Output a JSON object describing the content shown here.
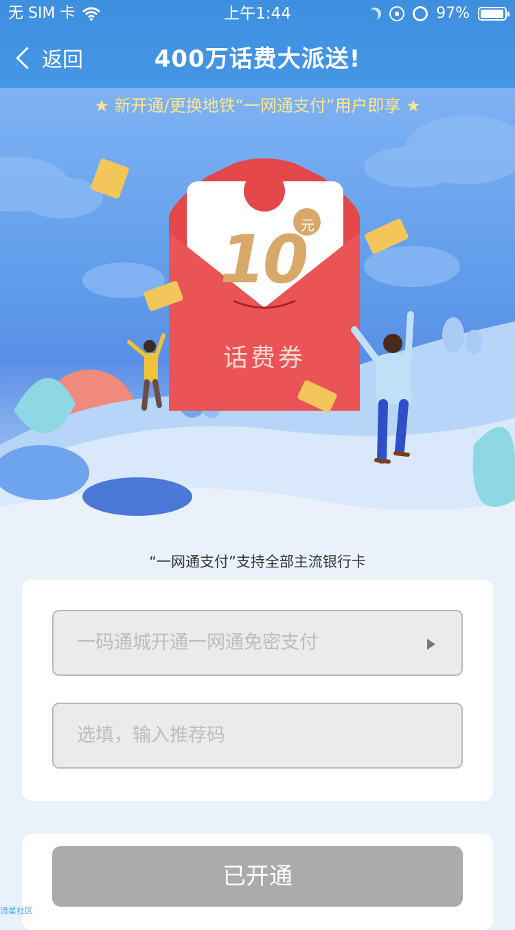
{
  "status_bar": {
    "carrier": "无 SIM 卡",
    "time": "上午1:44",
    "battery_percent": "97%",
    "battery_level": 0.97
  },
  "nav": {
    "back_label": "返回",
    "title": "400万话费大派送!"
  },
  "banner": {
    "subtitle": "★ 新开通/更换地铁“一网通支付”用户即享 ★",
    "coupon_unit": "元",
    "coupon_amount": "10",
    "coupon_label": "话费券",
    "ticket_text": "10"
  },
  "caption": "“一网通支付”支持全部主流银行卡",
  "form": {
    "payment_select_placeholder": "一码通城开通一网通免密支付",
    "referral_placeholder": "选填，输入推荐码"
  },
  "action": {
    "button_label": "已开通"
  },
  "watermark": "流星社区",
  "colors": {
    "nav_bg": "#4696e6",
    "subtitle": "#ffe58a",
    "envelope": "#e4474a",
    "button_disabled": "#ababab"
  }
}
